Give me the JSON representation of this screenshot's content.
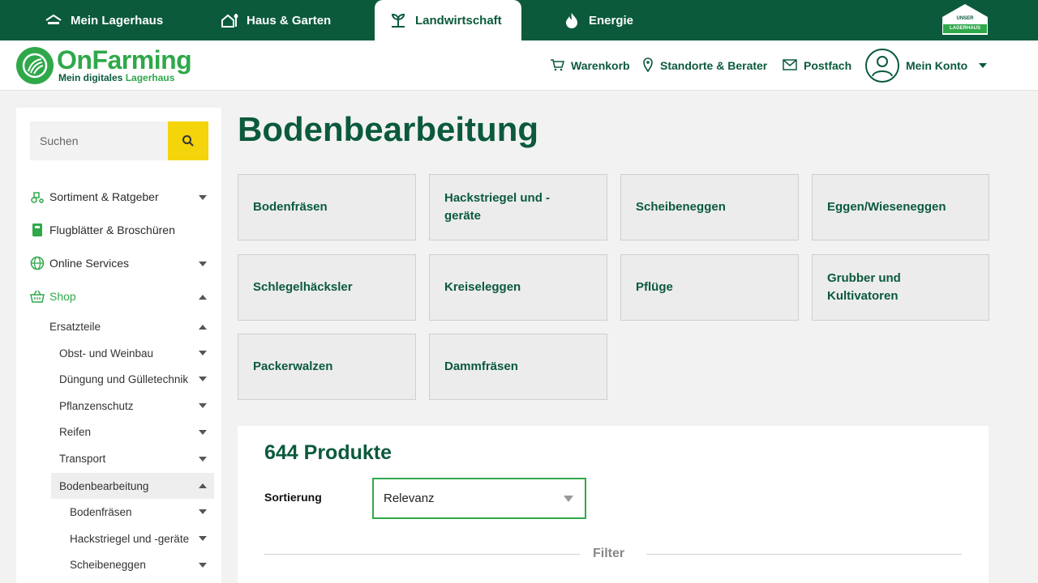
{
  "topnav": {
    "items": [
      {
        "label": "Mein Lagerhaus",
        "icon": "house-icon"
      },
      {
        "label": "Haus & Garten",
        "icon": "house-garden-icon"
      },
      {
        "label": "Landwirtschaft",
        "icon": "sprout-icon",
        "active": true
      },
      {
        "label": "Energie",
        "icon": "flame-icon"
      }
    ],
    "badge": {
      "line1": "UNSER",
      "line2": "LAGERHAUS"
    }
  },
  "brand": {
    "name": "OnFarming",
    "tagline_prefix": "Mein digitales",
    "tagline_highlight": "Lagerhaus"
  },
  "header": {
    "cart": "Warenkorb",
    "locations": "Standorte & Berater",
    "mailbox": "Postfach",
    "account": "Mein Konto"
  },
  "sidebar": {
    "search_placeholder": "Suchen",
    "main_items": [
      {
        "label": "Sortiment & Ratgeber",
        "icon": "tractor-icon",
        "caret": "down"
      },
      {
        "label": "Flugblätter & Broschüren",
        "icon": "brochure-icon",
        "caret": null
      },
      {
        "label": "Online Services",
        "icon": "globe-icon",
        "caret": "down"
      },
      {
        "label": "Shop",
        "icon": "basket-icon",
        "caret": "up",
        "active": true
      }
    ],
    "sub_items": [
      {
        "label": "Ersatzteile",
        "level": 1,
        "caret": "up",
        "active": true
      },
      {
        "label": "Obst- und Weinbau",
        "level": 2,
        "caret": "down"
      },
      {
        "label": "Düngung und Gülletechnik",
        "level": 2,
        "caret": "down"
      },
      {
        "label": "Pflanzenschutz",
        "level": 2,
        "caret": "down"
      },
      {
        "label": "Reifen",
        "level": 2,
        "caret": "down"
      },
      {
        "label": "Transport",
        "level": 2,
        "caret": "down"
      },
      {
        "label": "Bodenbearbeitung",
        "level": 2,
        "caret": "up",
        "active": true
      },
      {
        "label": "Bodenfräsen",
        "level": 3,
        "caret": "down"
      },
      {
        "label": "Hackstriegel und -geräte",
        "level": 3,
        "caret": "down"
      },
      {
        "label": "Scheibeneggen",
        "level": 3,
        "caret": "down"
      }
    ]
  },
  "main": {
    "title": "Bodenbearbeitung",
    "categories": [
      {
        "line1": "Bodenfräsen",
        "line2": ""
      },
      {
        "line1": "Hackstriegel und -",
        "line2": "geräte"
      },
      {
        "line1": "Scheibeneggen",
        "line2": ""
      },
      {
        "line1": "Eggen/Wieseneggen",
        "line2": ""
      },
      {
        "line1": "Schlegelhäcksler",
        "line2": ""
      },
      {
        "line1": "Kreiseleggen",
        "line2": ""
      },
      {
        "line1": "Pflüge",
        "line2": ""
      },
      {
        "line1": "Grubber und",
        "line2": "Kultivatoren"
      },
      {
        "line1": "Packerwalzen",
        "line2": ""
      },
      {
        "line1": "Dammfräsen",
        "line2": ""
      }
    ],
    "product_count": "644 Produkte",
    "sort_label": "Sortierung",
    "sort_value": "Relevanz",
    "filter_label": "Filter"
  },
  "colors": {
    "primary": "#0b5a3c",
    "accent": "#2fa84a",
    "search_button": "#f4d40a"
  }
}
